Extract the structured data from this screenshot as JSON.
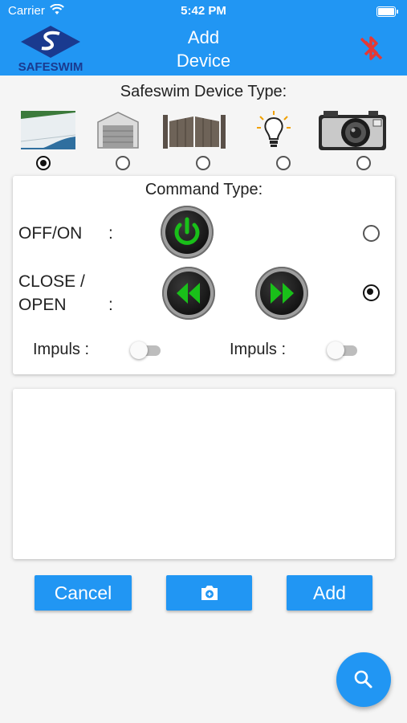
{
  "status_bar": {
    "carrier": "Carrier",
    "time": "5:42 PM"
  },
  "app_bar": {
    "title_line1": "Add",
    "title_line2": "Device",
    "logo_text": "SAFESWIM",
    "bluetooth_icon": "bluetooth-disabled-icon"
  },
  "device_type": {
    "label": "Safeswim Device Type:",
    "options": [
      {
        "icon": "pool-cover-icon",
        "selected": true
      },
      {
        "icon": "garage-door-icon",
        "selected": false
      },
      {
        "icon": "gate-icon",
        "selected": false
      },
      {
        "icon": "light-bulb-icon",
        "selected": false
      },
      {
        "icon": "camera-icon",
        "selected": false
      }
    ]
  },
  "command_type": {
    "label": "Command Type:",
    "off_on_label": "OFF/ON",
    "off_on_colon": ":",
    "close_label": "CLOSE /",
    "open_label": "OPEN",
    "close_open_colon": ":",
    "off_on_selected": false,
    "close_open_selected": true,
    "impuls_left": "Impuls :",
    "impuls_right": "Impuls :"
  },
  "buttons": {
    "cancel": "Cancel",
    "add": "Add",
    "photo_icon": "add-photo-icon"
  },
  "fab_icon": "search-icon",
  "colors": {
    "primary": "#2196f3",
    "button_green": "#19c019",
    "bluetooth_red": "#e53935"
  }
}
